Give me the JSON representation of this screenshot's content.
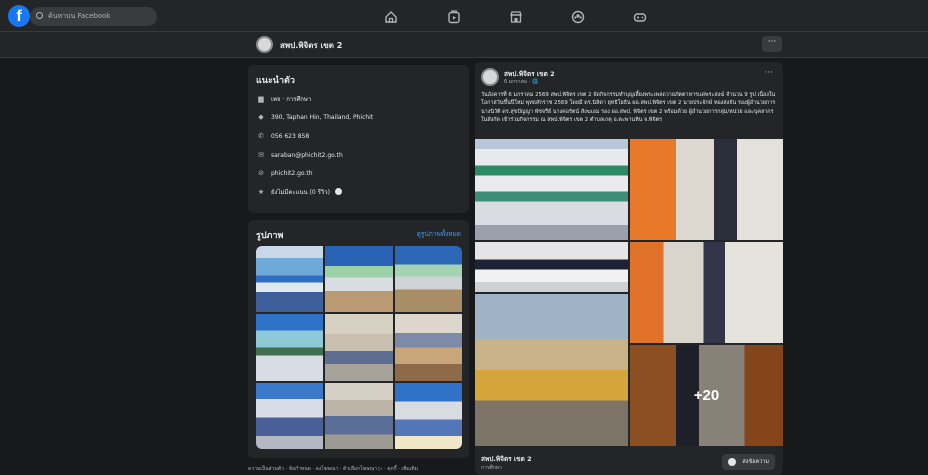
{
  "search": {
    "placeholder": "ค้นหาบน Facebook"
  },
  "nav_icons": [
    "home-icon",
    "video-icon",
    "marketplace-icon",
    "groups-icon",
    "gaming-icon"
  ],
  "page_header": {
    "title": "สพป.พิจิตร เขต 2",
    "more_label": "···"
  },
  "intro": {
    "title": "แนะนำตัว",
    "rows": [
      {
        "icon": "info-icon",
        "text": "เพจ · การศึกษา"
      },
      {
        "icon": "location-icon",
        "text": "390, Taphan Hin, Thailand, Phichit"
      },
      {
        "icon": "phone-icon",
        "text": "056 623 858"
      },
      {
        "icon": "email-icon",
        "text": "saraban@phichit2.go.th"
      },
      {
        "icon": "link-icon",
        "text": "phichit2.go.th"
      },
      {
        "icon": "star-icon",
        "text": "ยังไม่มีคะแนน (0 รีวิว)"
      }
    ]
  },
  "photos": {
    "title": "รูปภาพ",
    "see_all": "ดูรูปภาพทั้งหมด"
  },
  "footer": {
    "links": "ความเป็นส่วนตัว · ข้อกำหนด · ลงโฆษณา · ตัวเลือกโฆษณา ▷ · คุกกี้ · เพิ่มเติม"
  },
  "post": {
    "author": "สพป.พิจิตร เขต 2",
    "date": "6 มกราคม · 🌐",
    "more_label": "···",
    "text": "วันอังคารที่ 6 มกราคม 2569 สพป.พิจิตร เขต 2 จัดกิจกรรมทำบุญเลี้ยงพระเพลถวายภัตตาหารแด่พระสงฆ์ จำนวน 9 รูป เนื่องในโอกาสวันขึ้นปีใหม่ พุทธศักราช 2569 โดยมี ดร.นิลิดา ยุทธิโยธิน ผอ.สพป.พิจิตร เขต 2 นายประจักษ์ ทองสงจัน รองผู้อำนวยการ นางนิวัติ ดร.สุขปัญญา พัชจรีย์ นางคอรัตน์ สังฆเอม รอง ผอ.สพป. พิจิตร เขต 2 พร้อมด้วย ผู้อำนวยการกลุ่ม/หน่วย และบุคลากรในสังกัด เข้าร่วมกิจกรรม ณ สพป.พิจิตร เขต 2 ตำบลเกตุ อ.ตะพานหิน จ.พิจิตร",
    "more_photos": "+20",
    "footer_name": "สพป.พิจิตร เขต 2",
    "footer_category": "การศึกษา",
    "message_button": "ส่งข้อความ"
  },
  "colors": {
    "bg": "#18191a",
    "surface": "#242526",
    "accent": "#1877f2",
    "link": "#4599ff"
  }
}
